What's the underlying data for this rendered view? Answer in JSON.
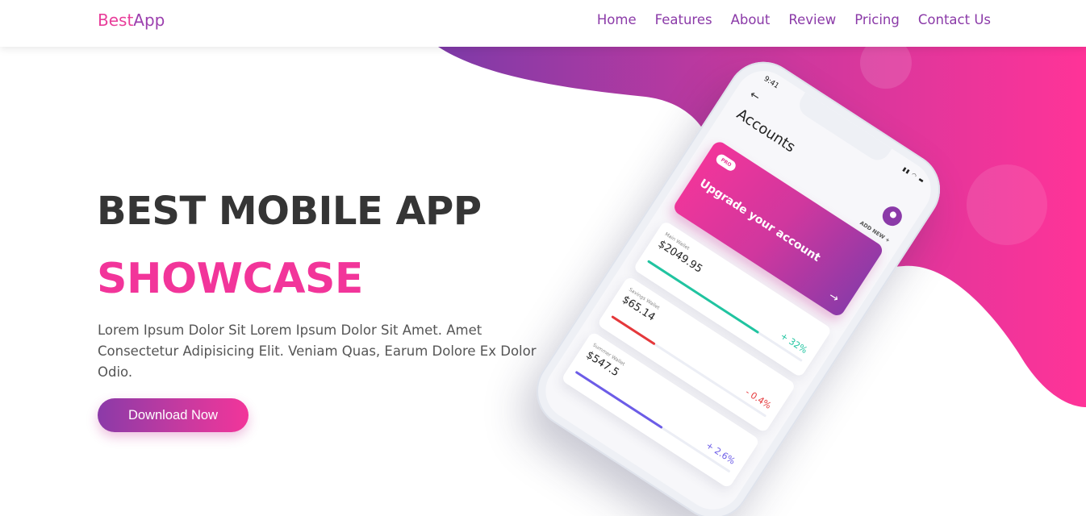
{
  "header": {
    "logo_part1": "Best",
    "logo_part2": "App",
    "nav": [
      "Home",
      "Features",
      "About",
      "Review",
      "Pricing",
      "Contact Us"
    ]
  },
  "hero": {
    "title": "BEST MOBILE APP",
    "subtitle": "SHOWCASE",
    "description": "Lorem Ipsum Dolor Sit Lorem Ipsum Dolor Sit Amet. Amet Consectetur Adipisicing Elit. Veniam Quas, Earum Dolore Ex Dolor Odio.",
    "cta": "Download Now"
  },
  "phone": {
    "time": "9:41",
    "title": "Accounts",
    "add_new": "ADD NEW +",
    "promo_badge": "PRO",
    "promo_text": "Upgrade your account",
    "wallets": [
      {
        "label": "Main Wallet",
        "amount": "$2049.95",
        "change": "+ 32%",
        "progress": 0.72,
        "color": "#20c4a0"
      },
      {
        "label": "Savings Wallet",
        "amount": "$65.14",
        "change": "- 0.4%",
        "progress": 0.28,
        "color": "#e5383b"
      },
      {
        "label": "Summer Wallet",
        "amount": "$547.5",
        "change": "+ 2.6%",
        "progress": 0.56,
        "color": "#6c5ce7"
      }
    ]
  },
  "colors": {
    "brand_pink": "#f2359a",
    "brand_purple": "#8b3aa8",
    "heading_dark": "#353535"
  },
  "icons": {
    "back": "arrow-left-icon",
    "avatar": "user-avatar-icon",
    "promo_arrow": "arrow-right-icon"
  }
}
